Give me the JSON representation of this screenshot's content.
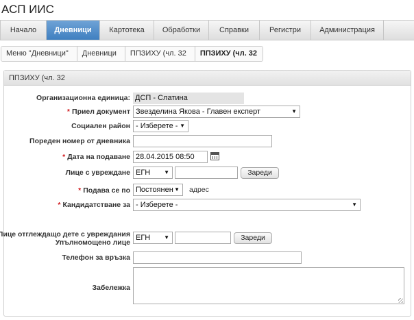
{
  "app": {
    "title": "АСП ИИС"
  },
  "nav": {
    "items": [
      {
        "label": "Начало"
      },
      {
        "label": "Дневници"
      },
      {
        "label": "Картотека"
      },
      {
        "label": "Обработки"
      },
      {
        "label": "Справки"
      },
      {
        "label": "Регистри"
      },
      {
        "label": "Администрация"
      }
    ],
    "active": "Дневници"
  },
  "breadcrumb": [
    "Меню \"Дневници\"",
    "Дневници",
    "ППЗИХУ (чл. 32",
    "ППЗИХУ (чл. 32"
  ],
  "panel": {
    "title": "ППЗИХУ (чл. 32"
  },
  "form": {
    "org_unit": {
      "label": "Организационна единица:",
      "value": "ДСП - Слатина"
    },
    "received_by": {
      "label": "Приел документ",
      "value": "Звезделина Якова - Главен експерт"
    },
    "social_area": {
      "label": "Социален район",
      "value": "- Изберете -"
    },
    "journal_number": {
      "label": "Пореден номер от дневника",
      "value": ""
    },
    "submit_date": {
      "label": "Дата на подаване",
      "value": "28.04.2015 08:50"
    },
    "disabled_person": {
      "label": "Лице с увреждане",
      "id_type": "ЕГН",
      "value": "",
      "load_button": "Зареди"
    },
    "submitted_at": {
      "label": "Подава се по",
      "value": "Постоянен",
      "suffix": "адрес"
    },
    "applying_for": {
      "label": "Кандидатстване за",
      "value": "- Изберете -"
    },
    "caregiver": {
      "label_line1": "Лице отглеждащо дете с увреждания",
      "label_line2": "Упълномощено лице",
      "id_type": "ЕГН",
      "value": "",
      "load_button": "Зареди"
    },
    "phone": {
      "label": "Телефон за връзка",
      "value": ""
    },
    "note": {
      "label": "Забележка",
      "value": ""
    }
  },
  "colors": {
    "nav_active": "#4a88c8",
    "required_star": "#d0181c"
  },
  "icons": {
    "calendar": "calendar-icon",
    "dropdown": "chevron-down-icon"
  }
}
